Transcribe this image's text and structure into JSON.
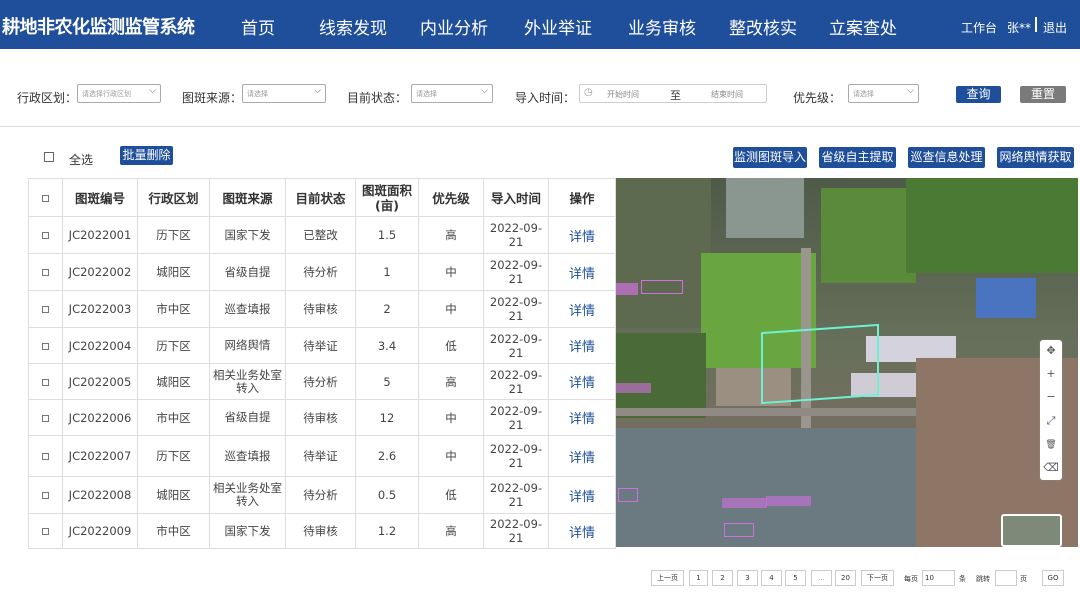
{
  "header": {
    "title": "耕地非农化监测监管系统",
    "nav": [
      "首页",
      "线索发现",
      "内业分析",
      "外业举证",
      "业务审核",
      "整改核实",
      "立案查处"
    ],
    "workbench": "工作台",
    "user": "张**",
    "logout": "退出"
  },
  "filters": {
    "region_label": "行政区划：",
    "region_placeholder": "请选择行政区划",
    "source_label": "图斑来源：",
    "source_placeholder": "请选择",
    "status_label": "目前状态：",
    "status_placeholder": "请选择",
    "import_label": "导入时间：",
    "start_placeholder": "开始时间",
    "to": "至",
    "end_placeholder": "结束时间",
    "priority_label": "优先级：",
    "priority_placeholder": "请选择",
    "query": "查询",
    "reset": "重置"
  },
  "toolbar": {
    "select_all": "全选",
    "batch_delete": "批量删除",
    "actions": [
      "监测图斑导入",
      "省级自主提取",
      "巡查信息处理",
      "网络舆情获取"
    ]
  },
  "table": {
    "headers": [
      "图斑编号",
      "行政区划",
      "图斑来源",
      "目前状态",
      "图斑面积\n(亩)",
      "优先级",
      "导入时间",
      "操作"
    ],
    "rows": [
      [
        "JC2022001",
        "历下区",
        "国家下发",
        "已整改",
        "1.5",
        "高",
        "2022-09-21",
        "详情"
      ],
      [
        "JC2022002",
        "城阳区",
        "省级自提",
        "待分析",
        "1",
        "中",
        "2022-09-21",
        "详情"
      ],
      [
        "JC2022003",
        "市中区",
        "巡查填报",
        "待审核",
        "2",
        "中",
        "2022-09-21",
        "详情"
      ],
      [
        "JC2022004",
        "历下区",
        "网络舆情",
        "待举证",
        "3.4",
        "低",
        "2022-09-21",
        "详情"
      ],
      [
        "JC2022005",
        "城阳区",
        "相关业务处室\n转入",
        "待分析",
        "5",
        "高",
        "2022-09-21",
        "详情"
      ],
      [
        "JC2022006",
        "市中区",
        "省级自提",
        "待审核",
        "12",
        "中",
        "2022-09-21",
        "详情"
      ],
      [
        "JC2022007",
        "历下区",
        "巡查填报",
        "待举证",
        "2.6",
        "中",
        "2022-09-21",
        "详情"
      ],
      [
        "JC2022008",
        "城阳区",
        "相关业务处室\n转入",
        "待分析",
        "0.5",
        "低",
        "2022-09-21",
        "详情"
      ],
      [
        "JC2022009",
        "市中区",
        "国家下发",
        "待审核",
        "1.2",
        "高",
        "2022-09-21",
        "详情"
      ]
    ]
  },
  "map": {
    "tools": [
      "move-icon",
      "zoom-in-icon",
      "zoom-out-icon",
      "fullscreen-icon",
      "delete-icon",
      "eraser-icon"
    ],
    "tool_glyphs": [
      "✥",
      "+",
      "−",
      "⤢",
      "🗑",
      "⌫"
    ],
    "highlight_color": "#6ff0d0",
    "label_color": "#d070e0"
  },
  "pagination": {
    "prev": "上一页",
    "pages": [
      "1",
      "2",
      "3",
      "4",
      "5",
      "...",
      "20"
    ],
    "next": "下一页",
    "per_page_label": "每页",
    "per_page_value": "10",
    "per_page_unit": "条",
    "jump_label": "跳转",
    "page_unit": "页",
    "go": "GO"
  }
}
